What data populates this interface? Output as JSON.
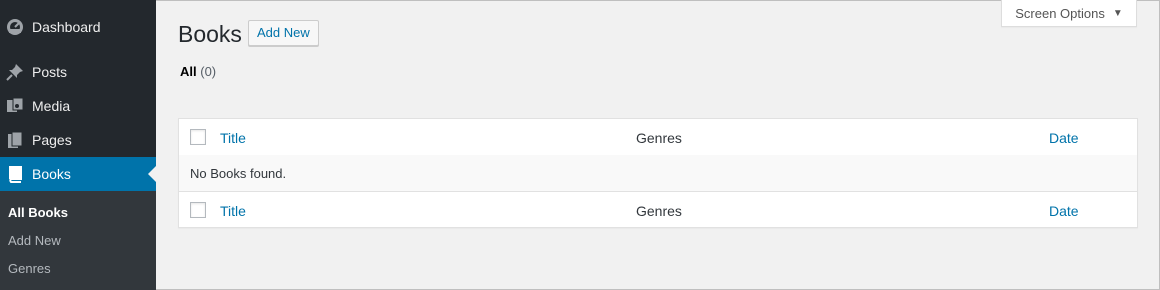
{
  "sidebar": {
    "items": [
      {
        "label": "Dashboard",
        "icon": "dashboard-icon"
      },
      {
        "label": "Posts",
        "icon": "pushpin-icon"
      },
      {
        "label": "Media",
        "icon": "media-icon"
      },
      {
        "label": "Pages",
        "icon": "pages-icon"
      },
      {
        "label": "Books",
        "icon": "book-icon",
        "current": true
      }
    ],
    "submenu": [
      {
        "label": "All Books",
        "current": true
      },
      {
        "label": "Add New"
      },
      {
        "label": "Genres"
      }
    ],
    "colors": {
      "bg": "#23282d",
      "submenu_bg": "#32373c",
      "current_bg": "#0073aa"
    }
  },
  "header": {
    "title": "Books",
    "add_new_label": "Add New",
    "screen_options_label": "Screen Options"
  },
  "filters": {
    "all_label": "All",
    "all_count": "(0)"
  },
  "table": {
    "columns": [
      "Title",
      "Genres",
      "Date"
    ],
    "empty_message": "No Books found."
  },
  "colors": {
    "link": "#0073aa",
    "page_bg": "#f1f1f1"
  }
}
